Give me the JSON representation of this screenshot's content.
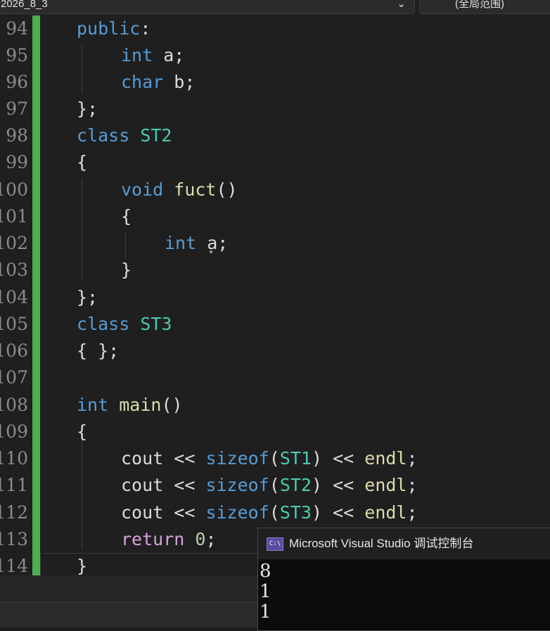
{
  "navbar": {
    "project": "2026_8_3",
    "scope": "(全局范围)"
  },
  "editor": {
    "lines": [
      {
        "n": "94"
      },
      {
        "n": "95"
      },
      {
        "n": "96"
      },
      {
        "n": "97"
      },
      {
        "n": "98"
      },
      {
        "n": "99"
      },
      {
        "n": "100"
      },
      {
        "n": "101"
      },
      {
        "n": "102"
      },
      {
        "n": "103"
      },
      {
        "n": "104"
      },
      {
        "n": "105"
      },
      {
        "n": "106"
      },
      {
        "n": "107"
      },
      {
        "n": "108"
      },
      {
        "n": "109"
      },
      {
        "n": "110"
      },
      {
        "n": "111"
      },
      {
        "n": "112"
      },
      {
        "n": "113"
      },
      {
        "n": "114"
      }
    ],
    "tokens": {
      "public": "public",
      "colon": ":",
      "int": "int",
      "a": "a",
      "semi": ";",
      "char": "char",
      "b": "b",
      "close_brace_semi": "};",
      "class": "class",
      "ST1": "ST1",
      "ST2": "ST2",
      "ST3": "ST3",
      "open_brace": "{",
      "close_brace": "}",
      "void": "void",
      "fuct": "fuct",
      "parens": "()",
      "empty_class_body": "{ };",
      "main": "main",
      "cout": "cout",
      "shl": "<<",
      "sizeof": "sizeof",
      "lparen": "(",
      "rparen": ")",
      "endl": "endl",
      "return": "return",
      "zero": "0"
    }
  },
  "console": {
    "title": "Microsoft Visual Studio 调试控制台",
    "icon_label": "C:\\",
    "output": [
      "8",
      "1",
      "1"
    ]
  }
}
